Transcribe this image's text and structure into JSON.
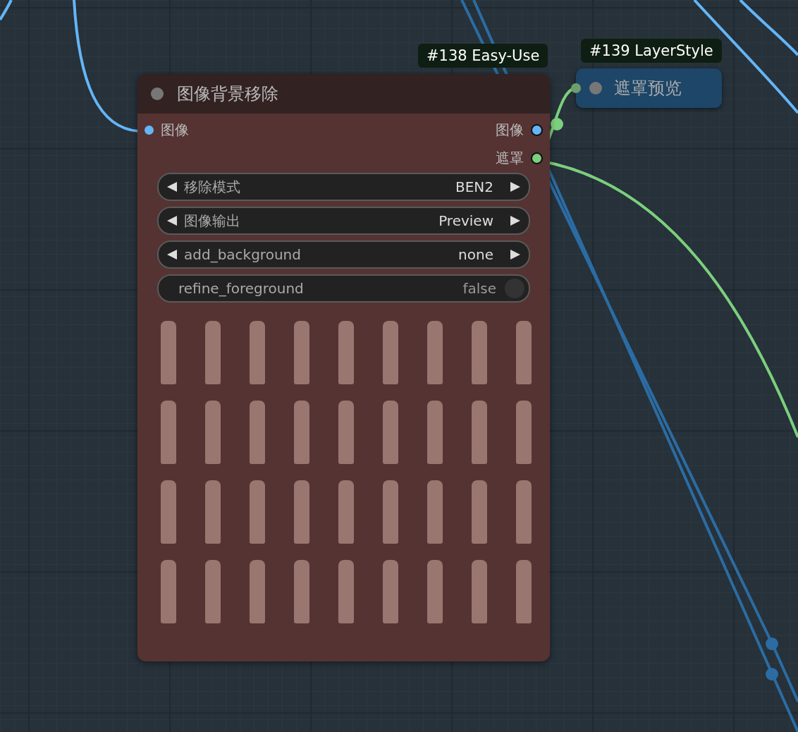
{
  "nodes": [
    {
      "kind": "expanded",
      "badge": "#138 Easy-Use",
      "title": "图像背景移除",
      "inputs": [
        {
          "label": "图像",
          "color": "#64b5f6"
        }
      ],
      "outputs": [
        {
          "label": "图像",
          "color": "#64b5f6"
        },
        {
          "label": "遮罩",
          "color": "#7ccf7c"
        }
      ],
      "widgets": [
        {
          "kind": "combo",
          "label": "移除模式",
          "value": "BEN2"
        },
        {
          "kind": "combo",
          "label": "图像输出",
          "value": "Preview"
        },
        {
          "kind": "combo",
          "label": "add_background",
          "value": "none"
        },
        {
          "kind": "toggle",
          "label": "refine_foreground",
          "value": "false",
          "on": false
        }
      ]
    },
    {
      "kind": "collapsed",
      "badge": "#139 LayerStyle",
      "title": "遮罩预览"
    }
  ]
}
